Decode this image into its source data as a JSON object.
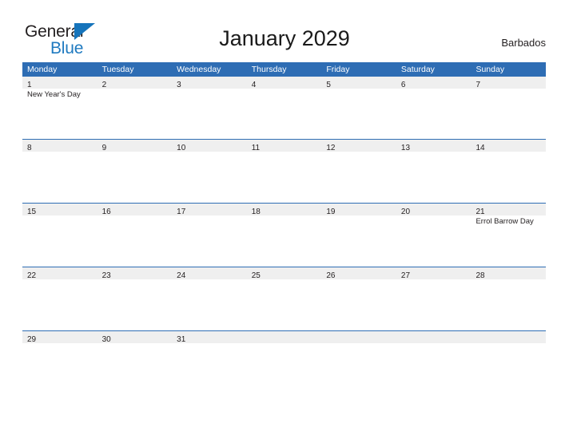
{
  "brand": {
    "name_part1": "General",
    "name_part2": "Blue",
    "triangle_icon": "blue-triangle-icon",
    "color_dark": "#231f20",
    "color_blue": "#1f7ac0"
  },
  "header": {
    "title": "January 2029",
    "country": "Barbados"
  },
  "colors": {
    "header_blue": "#2e6db4",
    "band_gray": "#efefef",
    "text": "#231f20",
    "page_background": "#ffffff"
  },
  "calendar": {
    "month": "January",
    "year": "2029",
    "weekdays": [
      "Monday",
      "Tuesday",
      "Wednesday",
      "Thursday",
      "Friday",
      "Saturday",
      "Sunday"
    ],
    "weeks": [
      {
        "days": [
          {
            "num": "1",
            "event": "New Year's Day"
          },
          {
            "num": "2",
            "event": ""
          },
          {
            "num": "3",
            "event": ""
          },
          {
            "num": "4",
            "event": ""
          },
          {
            "num": "5",
            "event": ""
          },
          {
            "num": "6",
            "event": ""
          },
          {
            "num": "7",
            "event": ""
          }
        ]
      },
      {
        "days": [
          {
            "num": "8",
            "event": ""
          },
          {
            "num": "9",
            "event": ""
          },
          {
            "num": "10",
            "event": ""
          },
          {
            "num": "11",
            "event": ""
          },
          {
            "num": "12",
            "event": ""
          },
          {
            "num": "13",
            "event": ""
          },
          {
            "num": "14",
            "event": ""
          }
        ]
      },
      {
        "days": [
          {
            "num": "15",
            "event": ""
          },
          {
            "num": "16",
            "event": ""
          },
          {
            "num": "17",
            "event": ""
          },
          {
            "num": "18",
            "event": ""
          },
          {
            "num": "19",
            "event": ""
          },
          {
            "num": "20",
            "event": ""
          },
          {
            "num": "21",
            "event": "Errol Barrow Day"
          }
        ]
      },
      {
        "days": [
          {
            "num": "22",
            "event": ""
          },
          {
            "num": "23",
            "event": ""
          },
          {
            "num": "24",
            "event": ""
          },
          {
            "num": "25",
            "event": ""
          },
          {
            "num": "26",
            "event": ""
          },
          {
            "num": "27",
            "event": ""
          },
          {
            "num": "28",
            "event": ""
          }
        ]
      },
      {
        "days": [
          {
            "num": "29",
            "event": ""
          },
          {
            "num": "30",
            "event": ""
          },
          {
            "num": "31",
            "event": ""
          },
          {
            "num": "",
            "event": ""
          },
          {
            "num": "",
            "event": ""
          },
          {
            "num": "",
            "event": ""
          },
          {
            "num": "",
            "event": ""
          }
        ]
      }
    ]
  }
}
